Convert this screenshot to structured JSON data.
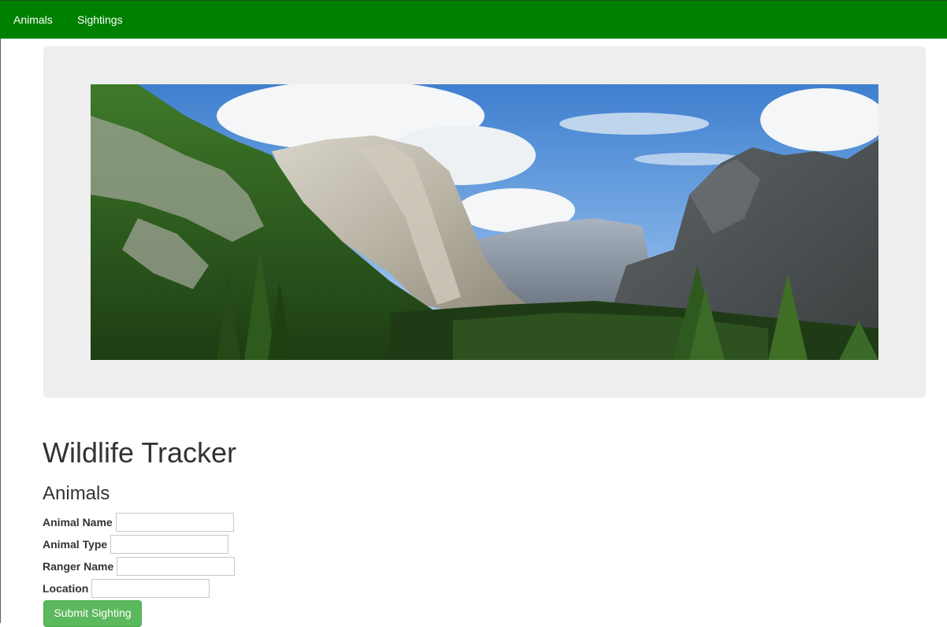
{
  "nav": {
    "items": [
      {
        "label": "Animals"
      },
      {
        "label": "Sightings"
      }
    ],
    "background_color": "#008000"
  },
  "hero": {
    "image_description_icon": "mountain-valley-photo"
  },
  "main": {
    "title": "Wildlife Tracker",
    "section_title": "Animals",
    "form": {
      "fields": [
        {
          "label": "Animal Name",
          "value": "",
          "placeholder": ""
        },
        {
          "label": "Animal Type",
          "value": "",
          "placeholder": ""
        },
        {
          "label": "Ranger Name",
          "value": "",
          "placeholder": ""
        },
        {
          "label": "Location",
          "value": "",
          "placeholder": ""
        }
      ],
      "submit_label": "Submit Sighting",
      "submit_color": "#5cb85c"
    }
  }
}
